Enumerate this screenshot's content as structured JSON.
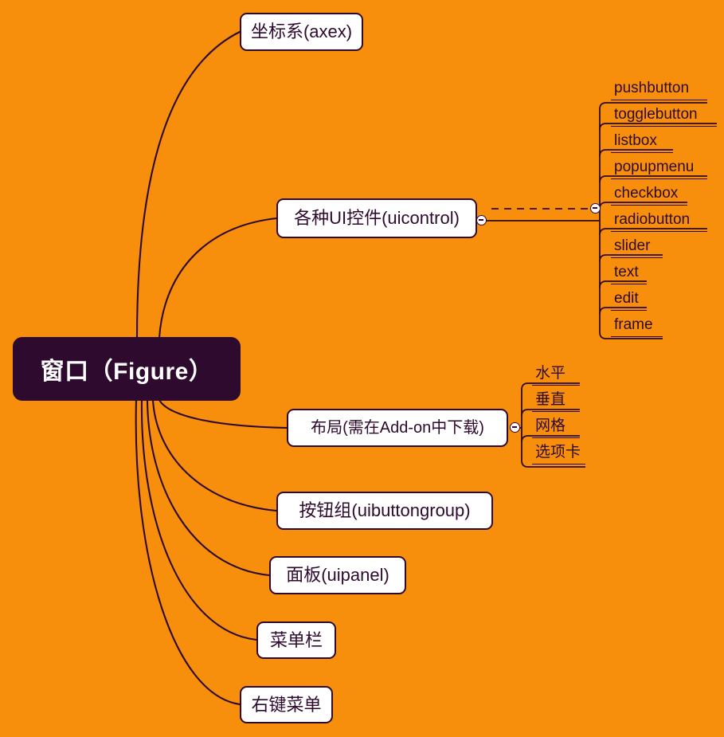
{
  "theme": {
    "background": "#F78F0C",
    "ink": "#2E0A2E",
    "node_fill": "#FFFFFF",
    "root_fill": "#2E0A2E",
    "root_text": "#FFFFFF"
  },
  "root": {
    "label": "窗口（Figure）"
  },
  "branches": [
    {
      "id": "axes",
      "label": "坐标系(axex)"
    },
    {
      "id": "uicontrol",
      "label": "各种UI控件(uicontrol)"
    },
    {
      "id": "layout",
      "label": "布局(需在Add-on中下载)"
    },
    {
      "id": "buttongroup",
      "label": "按钮组(uibuttongroup)"
    },
    {
      "id": "panel",
      "label": "面板(uipanel)"
    },
    {
      "id": "menubar",
      "label": "菜单栏"
    },
    {
      "id": "contextmenu",
      "label": "右键菜单"
    }
  ],
  "uicontrol_children": [
    {
      "label": "pushbutton"
    },
    {
      "label": "togglebutton"
    },
    {
      "label": "listbox"
    },
    {
      "label": "popupmenu"
    },
    {
      "label": "checkbox"
    },
    {
      "label": "radiobutton"
    },
    {
      "label": "slider"
    },
    {
      "label": "text"
    },
    {
      "label": "edit"
    },
    {
      "label": "frame"
    }
  ],
  "layout_children": [
    {
      "label": "水平"
    },
    {
      "label": "垂直"
    },
    {
      "label": "网格"
    },
    {
      "label": "选项卡"
    }
  ],
  "handles": {
    "uicontrol_left": "collapse-toggle",
    "uicontrol_right": "collapse-toggle",
    "layout_right": "collapse-toggle"
  }
}
